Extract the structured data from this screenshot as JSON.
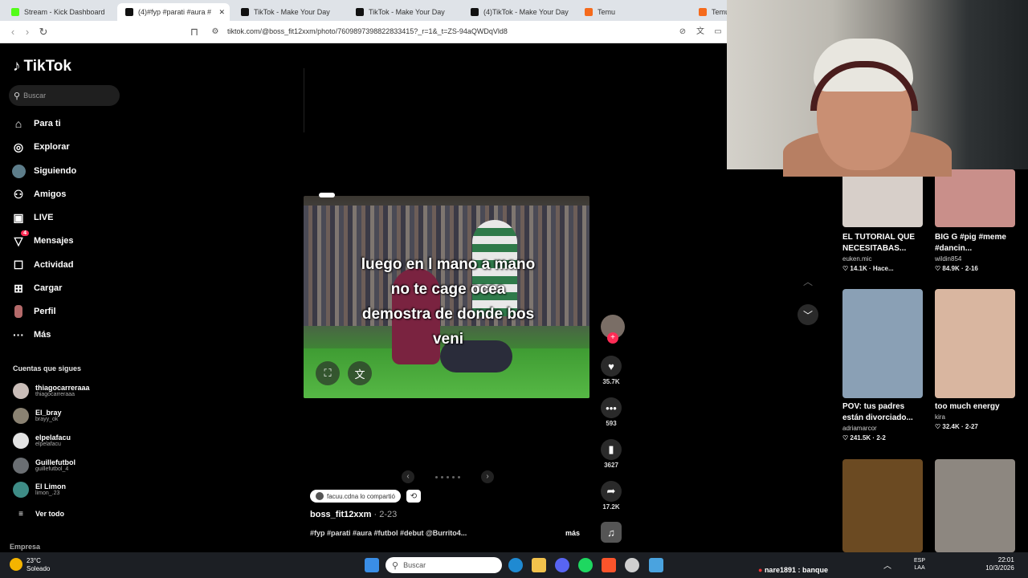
{
  "browser": {
    "tabs": [
      {
        "label": "Stream - Kick Dashboard",
        "favicon": "#53fc18"
      },
      {
        "label": "(4)#fyp #parati #aura #",
        "favicon": "#111111"
      },
      {
        "label": "TikTok - Make Your Day",
        "favicon": "#111111"
      },
      {
        "label": "TikTok - Make Your Day",
        "favicon": "#111111"
      },
      {
        "label": "(4)TikTok - Make Your Day",
        "favicon": "#111111"
      },
      {
        "label": "Temu",
        "favicon": "#f56a1c"
      },
      {
        "label": "Temu",
        "favicon": "#f56a1c"
      }
    ],
    "url": "tiktok.com/@boss_fit12xxm/photo/7609897398822833415?_r=1&_t=ZS-94aQWDqVld8"
  },
  "sidebar": {
    "logo": "TikTok",
    "search_placeholder": "Buscar",
    "nav": [
      {
        "label": "Para ti",
        "icon": "home-icon"
      },
      {
        "label": "Explorar",
        "icon": "compass-icon"
      },
      {
        "label": "Siguiendo",
        "icon": "following-icon"
      },
      {
        "label": "Amigos",
        "icon": "friends-icon"
      },
      {
        "label": "LIVE",
        "icon": "live-icon"
      },
      {
        "label": "Mensajes",
        "icon": "messages-icon"
      },
      {
        "label": "Actividad",
        "icon": "activity-icon"
      },
      {
        "label": "Cargar",
        "icon": "upload-icon"
      },
      {
        "label": "Perfil",
        "icon": "profile-icon"
      },
      {
        "label": "Más",
        "icon": "more-icon"
      }
    ],
    "messages_badge": "4",
    "following_title": "Cuentas que sigues",
    "following": [
      {
        "name": "thiagocarreraaa",
        "handle": "thiagocarreraaa"
      },
      {
        "name": "El_bray",
        "handle": "brayy_ok"
      },
      {
        "name": "elpelafacu",
        "handle": "elpelafacu"
      },
      {
        "name": "Guillefutbol",
        "handle": "guillefutbol_4"
      },
      {
        "name": "El Limon",
        "handle": "limon_.23"
      }
    ],
    "see_all": "Ver todo",
    "company": "Empresa"
  },
  "post": {
    "caption_lines": [
      "luego en l mano a mano",
      "no te cage ocea",
      "demostra de donde bos",
      "veni"
    ],
    "shared_by": "facuu.cdna lo compartió",
    "author": "boss_fit12xxm",
    "date": "2-23",
    "description": "#fyp #parati #aura #futbol #debut @Burrito4...",
    "more": "más",
    "likes": "35.7K",
    "comments": "593",
    "saves": "3627",
    "shares": "17.2K"
  },
  "grid": [
    {
      "title": "EL TUTORIAL QUE NECESITABAS...",
      "user": "euken.mic",
      "stats": "14.1K · Hace...",
      "color": "#d7cfc9"
    },
    {
      "title": "BIG G #pig #meme #dancin...",
      "user": "wildin854",
      "stats": "84.9K · 2-16",
      "color": "#c98f8a"
    },
    {
      "title": "POV: tus padres están divorciado...",
      "user": "adriamarcor",
      "stats": "241.5K · 2-2",
      "color": "#8aa0b5"
    },
    {
      "title": "too much energy",
      "user": "kira",
      "stats": "32.4K · 2-27",
      "color": "#d9b6a0"
    },
    {
      "title": "",
      "user": "",
      "stats": "",
      "color": "#6b4a22"
    },
    {
      "title": "",
      "user": "",
      "stats": "",
      "color": "#8d8780"
    }
  ],
  "stream_overlay": {
    "chat": "nare1891 : banque"
  },
  "taskbar": {
    "weather_temp": "23°C",
    "weather_desc": "Soleado",
    "search": "Buscar",
    "lang": "ESP",
    "lang2": "LAA",
    "time": "22:01",
    "date": "10/3/2026"
  }
}
